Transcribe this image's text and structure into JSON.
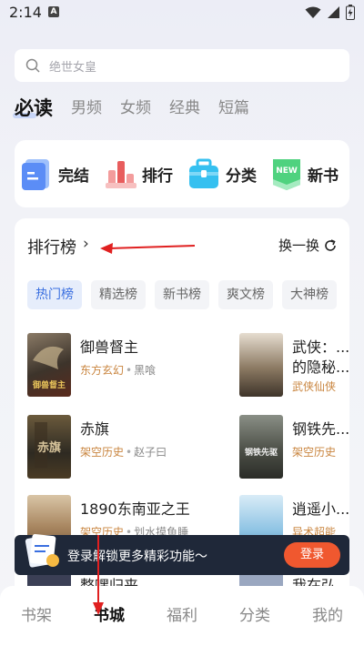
{
  "status_bar": {
    "time": "2:14",
    "notification_badge": "A"
  },
  "search": {
    "placeholder": "绝世女皇"
  },
  "top_tabs": [
    {
      "label": "必读",
      "active": true
    },
    {
      "label": "男频",
      "active": false
    },
    {
      "label": "女频",
      "active": false
    },
    {
      "label": "经典",
      "active": false
    },
    {
      "label": "短篇",
      "active": false
    }
  ],
  "quick_links": [
    {
      "label": "完结",
      "icon": "finished-icon",
      "color": "#6f9bf7"
    },
    {
      "label": "排行",
      "icon": "ranking-icon",
      "color": "#f07878"
    },
    {
      "label": "分类",
      "icon": "category-icon",
      "color": "#35c0f0"
    },
    {
      "label": "新书",
      "icon": "new-book-icon",
      "color": "#4fd27f",
      "badge": "NEW"
    }
  ],
  "ranking": {
    "title": "排行榜",
    "chevron": "›",
    "swap_label": "换一换",
    "chips": [
      {
        "label": "热门榜",
        "active": true
      },
      {
        "label": "精选榜",
        "active": false
      },
      {
        "label": "新书榜",
        "active": false
      },
      {
        "label": "爽文榜",
        "active": false
      },
      {
        "label": "大神榜",
        "active": false
      }
    ],
    "left_books": [
      {
        "title": "御兽督主",
        "category": "东方玄幻",
        "author": "黑喰",
        "cover_text": "御兽督主"
      },
      {
        "title": "赤旗",
        "category": "架空历史",
        "author": "赵子曰",
        "cover_text": "赤旗"
      },
      {
        "title": "1890东南亚之王",
        "category": "架空历史",
        "author": "划水摸鱼睡",
        "cover_text": ""
      },
      {
        "title": "整嘿归来",
        "category": "",
        "author": "",
        "cover_text": ""
      }
    ],
    "right_books": [
      {
        "title": "武侠：...",
        "subtitle": "的隐秘...",
        "category": "武侠仙侠",
        "cover_text": ""
      },
      {
        "title": "钢铁先...",
        "category": "架空历史",
        "cover_text": "钢铁先驱"
      },
      {
        "title": "逍遥小...",
        "category": "异术超能",
        "cover_text": ""
      },
      {
        "title": "我在弘...",
        "category": "",
        "cover_text": ""
      }
    ]
  },
  "promo": {
    "text": "登录解锁更多精彩功能～",
    "button": "登录"
  },
  "bottom_nav": [
    {
      "label": "书架",
      "active": false
    },
    {
      "label": "书城",
      "active": true
    },
    {
      "label": "福利",
      "active": false
    },
    {
      "label": "分类",
      "active": false
    },
    {
      "label": "我的",
      "active": false
    }
  ],
  "colors": {
    "accent_blue": "#3a6fe0",
    "category_orange": "#c9853f",
    "promo_button": "#f0582f",
    "annotation_red": "#e02020"
  }
}
